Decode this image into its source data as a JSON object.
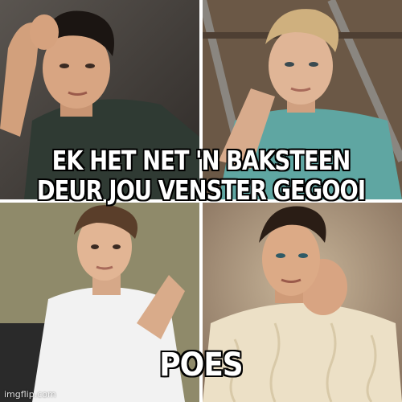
{
  "meme": {
    "top_caption_lines": [
      "EK HET NET 'N BAKSTEEN",
      "DEUR JOU VENSTER GEGOOI"
    ],
    "bottom_caption": "POES",
    "watermark": "imgflip.com",
    "text_color": "#ffffff",
    "outline_color": "#000000"
  },
  "panels": [
    {
      "description_icon": "man-dark-hair-green-shirt"
    },
    {
      "description_icon": "man-blond-hair-teal-shirt"
    },
    {
      "description_icon": "man-white-tshirt"
    },
    {
      "description_icon": "man-cream-sweater"
    }
  ]
}
